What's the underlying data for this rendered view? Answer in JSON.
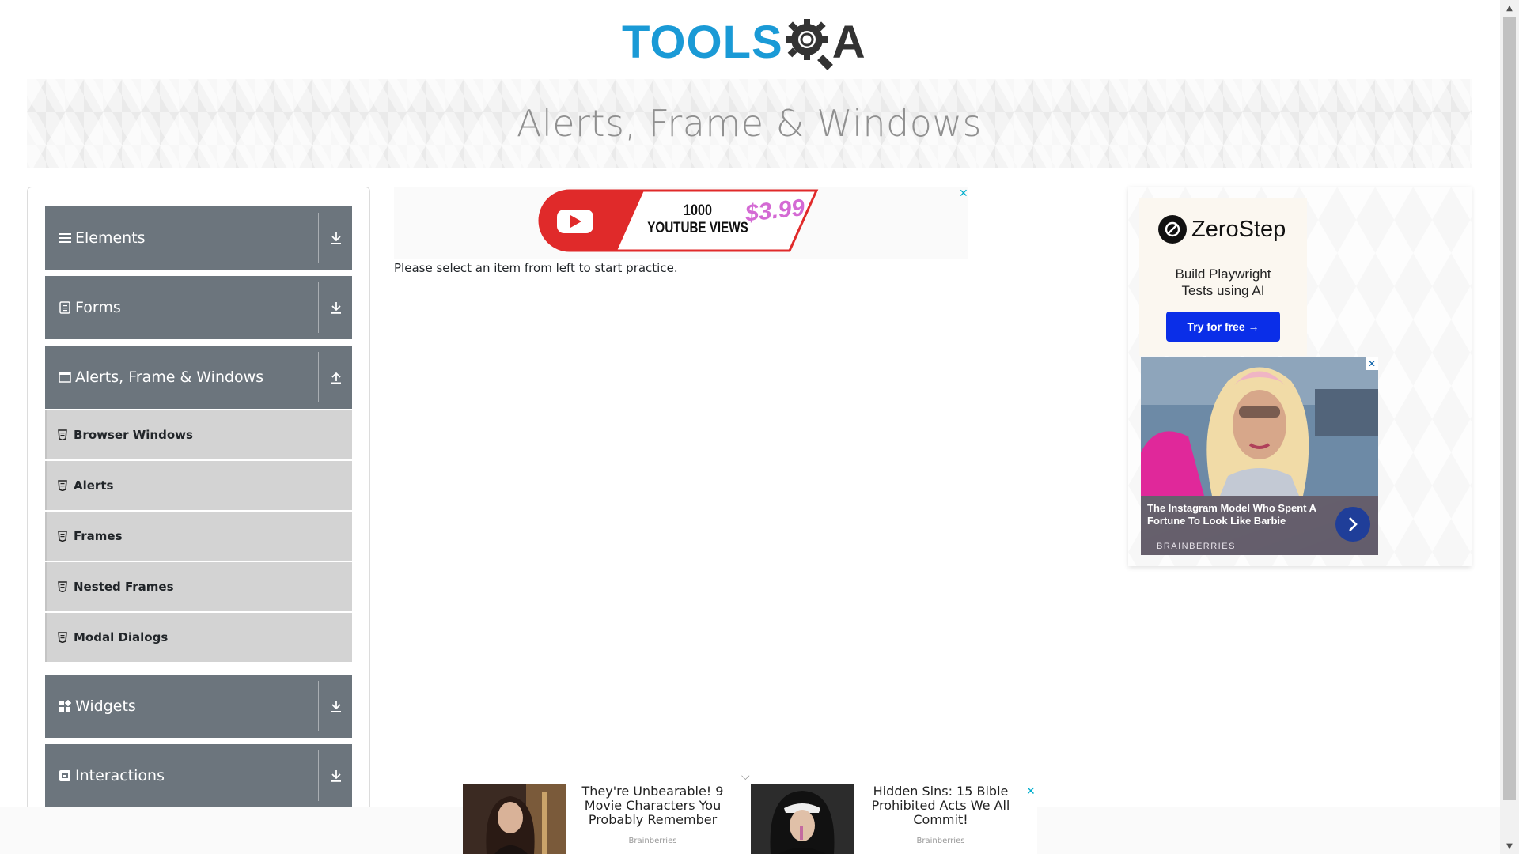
{
  "header": {
    "logo_main": "TOOLS",
    "logo_accent": "A"
  },
  "banner": {
    "title": "Alerts, Frame & Windows"
  },
  "sidebar": {
    "groups": [
      {
        "label": "Elements",
        "icon": "hamburger-icon",
        "expanded": false
      },
      {
        "label": "Forms",
        "icon": "form-icon",
        "expanded": false
      },
      {
        "label": "Alerts, Frame & Windows",
        "icon": "window-icon",
        "expanded": true,
        "items": [
          {
            "label": "Browser Windows"
          },
          {
            "label": "Alerts"
          },
          {
            "label": "Frames"
          },
          {
            "label": "Nested Frames"
          },
          {
            "label": "Modal Dialogs"
          }
        ]
      },
      {
        "label": "Widgets",
        "icon": "widgets-icon",
        "expanded": false
      },
      {
        "label": "Interactions",
        "icon": "interactions-icon",
        "expanded": false
      }
    ]
  },
  "main": {
    "top_ad": {
      "line1": "1000",
      "line2": "YOUTUBE VIEWS",
      "price": "$3.99",
      "close": "✕"
    },
    "instruction": "Please select an item from left to start practice."
  },
  "right_ad": {
    "zerostep": {
      "brand": "ZeroStep",
      "tagline_1": "Build Playwright",
      "tagline_2": "Tests using AI",
      "cta": "Try for free →"
    },
    "brainberries": {
      "title": "The Instagram Model Who Spent A Fortune To Look Like Barbie",
      "source": "BRAINBERRIES",
      "close": "✕"
    }
  },
  "bottom_ads": {
    "collapse": "⌵",
    "close": "✕",
    "items": [
      {
        "title": "They're Unbearable! 9 Movie Characters You Probably Remember",
        "source": "Brainberries"
      },
      {
        "title": "Hidden Sins: 15 Bible Prohibited Acts We All Commit!",
        "source": "Brainberries"
      }
    ]
  },
  "colors": {
    "logo_blue": "#1a9ad6",
    "group_header_bg": "#6c757d",
    "sub_item_bg": "#d3d3d3",
    "cta_blue": "#0a2ee8",
    "close_cyan": "#00aecd"
  }
}
